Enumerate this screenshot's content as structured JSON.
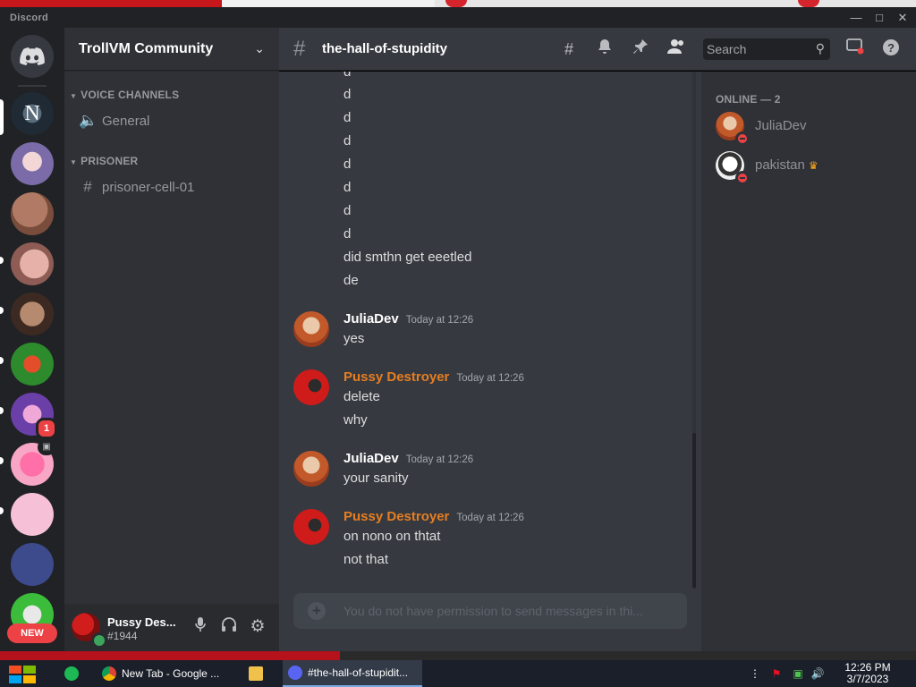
{
  "window": {
    "app_name": "Discord"
  },
  "guild": {
    "name": "TrollVM Community"
  },
  "categories": [
    {
      "name": "VOICE CHANNELS",
      "channels": [
        {
          "name": "General",
          "type": "voice"
        }
      ]
    },
    {
      "name": "PRISONER",
      "channels": [
        {
          "name": "prisoner-cell-01",
          "type": "text"
        }
      ]
    }
  ],
  "channel": {
    "name": "the-hall-of-stupidity"
  },
  "search": {
    "placeholder": "Search"
  },
  "rail": {
    "badges": {
      "server_7": "1"
    },
    "new_label": "NEW"
  },
  "user": {
    "name": "Pussy Des...",
    "tag": "#1944",
    "status_color": "#3ba55d"
  },
  "messages": {
    "continuation": [
      "d",
      "d",
      "d",
      "d",
      "d",
      "d",
      "d",
      "d",
      "did smthn get eeetled",
      "de"
    ],
    "groups": [
      {
        "author": "JuliaDev",
        "color": "#ffffff",
        "time": "Today at 12:26",
        "lines": [
          "yes"
        ]
      },
      {
        "author": "Pussy Destroyer",
        "color": "#e67e22",
        "time": "Today at 12:26",
        "lines": [
          "delete",
          "why"
        ]
      },
      {
        "author": "JuliaDev",
        "color": "#ffffff",
        "time": "Today at 12:26",
        "lines": [
          "your sanity"
        ]
      },
      {
        "author": "Pussy Destroyer",
        "color": "#e67e22",
        "time": "Today at 12:26",
        "lines": [
          "on nono on thtat",
          "not that"
        ]
      }
    ]
  },
  "composer": {
    "placeholder": "You do not have permission to send messages in thi..."
  },
  "members": {
    "category": "ONLINE — 2",
    "list": [
      {
        "name": "JuliaDev",
        "status": "dnd"
      },
      {
        "name": "pakistan",
        "status": "dnd",
        "owner": true
      }
    ]
  },
  "taskbar": {
    "items": [
      {
        "label": "New Tab - Google ..."
      },
      {
        "label": "#the-hall-of-stupidit..."
      }
    ],
    "clock_time": "12:26 PM",
    "clock_date": "3/7/2023"
  },
  "icons": {
    "server_rail": [
      "discord-home-icon",
      "server-icon"
    ],
    "header": [
      "threads-icon",
      "bell-icon",
      "pin-icon",
      "members-icon",
      "search-icon",
      "inbox-icon",
      "help-icon"
    ],
    "user_panel": [
      "microphone-icon",
      "headphones-icon",
      "gear-icon"
    ]
  },
  "colors": {
    "accent": "#5865f2",
    "danger": "#ed4245",
    "background": "#36393f",
    "sidebar": "#2f3136",
    "rail": "#202225"
  }
}
